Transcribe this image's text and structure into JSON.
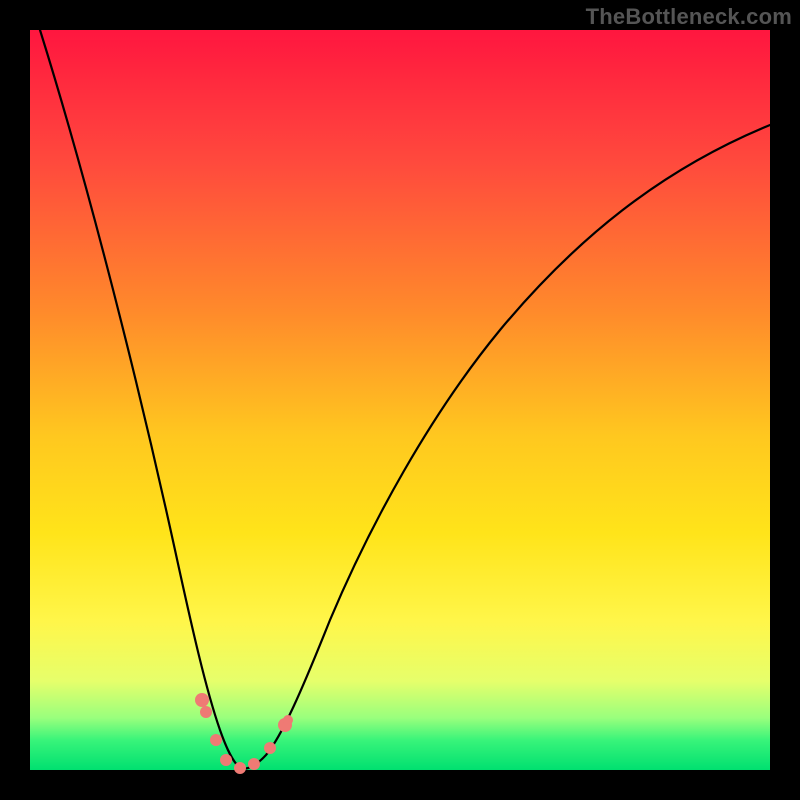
{
  "watermark": "TheBottleneck.com",
  "colors": {
    "frame_border": "#000000",
    "curve_stroke": "#000000",
    "marker_fill": "#ef7a74",
    "gradient_top": "#ff163f",
    "gradient_bottom": "#00e070"
  },
  "chart_data": {
    "type": "line",
    "title": "",
    "xlabel": "",
    "ylabel": "",
    "axes_hidden": true,
    "x": [
      0,
      2,
      4,
      6,
      8,
      10,
      12,
      14,
      16,
      18,
      20,
      22,
      24,
      26,
      28,
      30,
      35,
      40,
      45,
      50,
      55,
      60,
      65,
      70,
      75,
      80,
      85,
      90,
      95,
      100
    ],
    "values": [
      100,
      92,
      83,
      74,
      65,
      56,
      48,
      40,
      32,
      24,
      16,
      9,
      4,
      1,
      0,
      1,
      5,
      12,
      20,
      28,
      36,
      44,
      51,
      57,
      63,
      68,
      73,
      77,
      79,
      80
    ],
    "xlim": [
      0,
      100
    ],
    "ylim": [
      0,
      100
    ],
    "minimum_x": 27,
    "markers": [
      {
        "x": 22,
        "y": 9
      },
      {
        "x": 22.5,
        "y": 7
      },
      {
        "x": 24,
        "y": 4
      },
      {
        "x": 26,
        "y": 1
      },
      {
        "x": 28,
        "y": 0
      },
      {
        "x": 30,
        "y": 1
      },
      {
        "x": 32,
        "y": 3
      },
      {
        "x": 33.5,
        "y": 5.5
      },
      {
        "x": 34,
        "y": 6
      }
    ],
    "notes": "Bottleneck-style curve: single V-shaped line with a sharp minimum near x≈27. Background gradient encodes value (red high, green low). Pink dots cluster near the trough. No visible axes, ticks, grid, or labels."
  }
}
